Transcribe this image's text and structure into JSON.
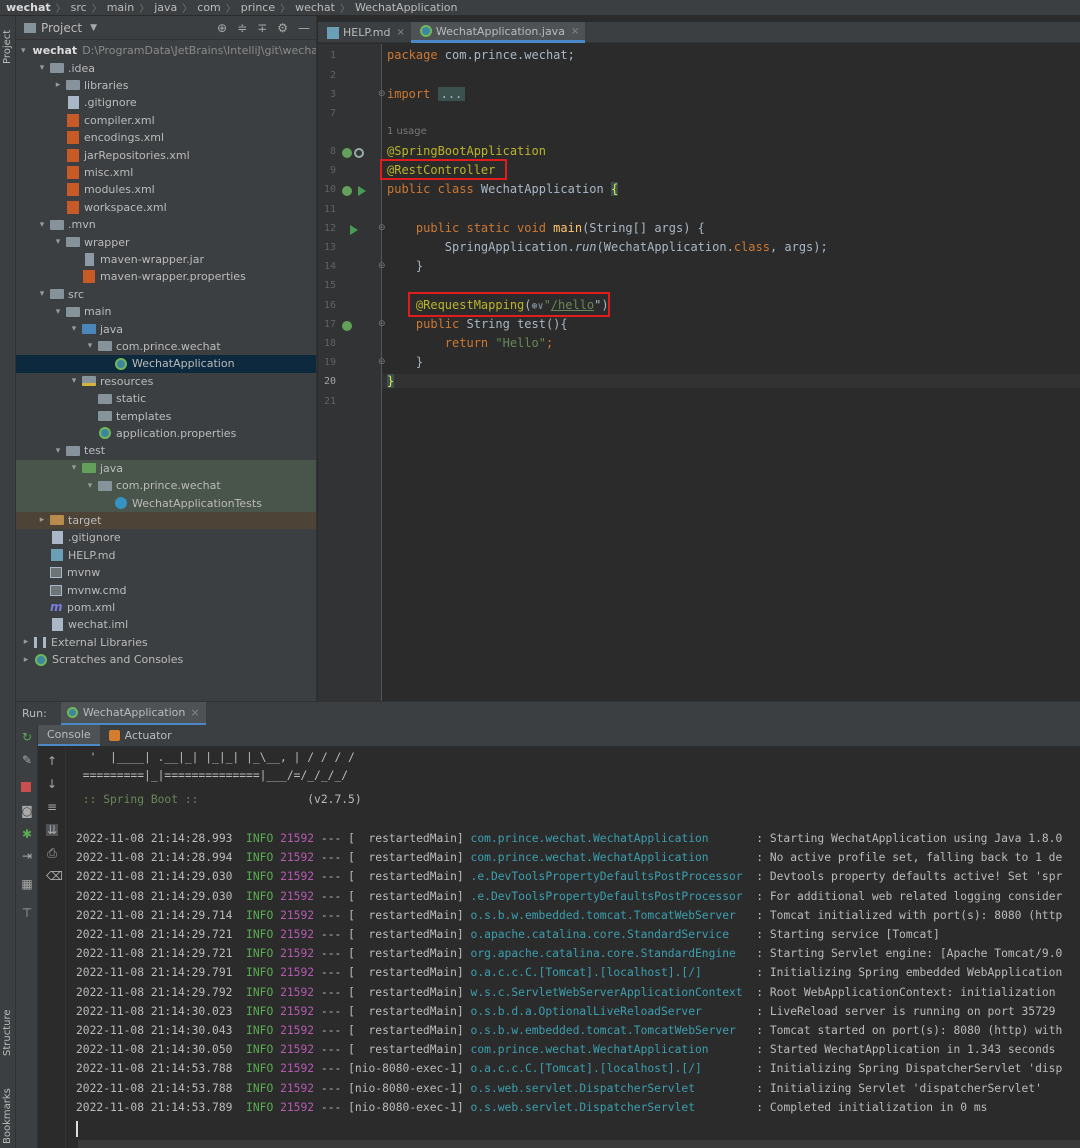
{
  "breadcrumb": [
    "wechat",
    "src",
    "main",
    "java",
    "com",
    "prince",
    "wechat",
    "WechatApplication"
  ],
  "left_strip": {
    "project_label": "Project",
    "structure_label": "Structure",
    "bookmarks_label": "Bookmarks"
  },
  "project_panel": {
    "title": "Project",
    "tree": [
      {
        "label": "wechat",
        "extra": "D:\\ProgramData\\JetBrains\\IntelliJ\\git\\wecha",
        "icon": "folder",
        "depth": 0,
        "arrow": "open",
        "bold": true
      },
      {
        "label": ".idea",
        "icon": "folder",
        "depth": 1,
        "arrow": "open"
      },
      {
        "label": "libraries",
        "icon": "folder",
        "depth": 2,
        "arrow": "closed"
      },
      {
        "label": ".gitignore",
        "icon": "file",
        "depth": 2
      },
      {
        "label": "compiler.xml",
        "icon": "xml",
        "depth": 2
      },
      {
        "label": "encodings.xml",
        "icon": "xml",
        "depth": 2
      },
      {
        "label": "jarRepositories.xml",
        "icon": "xml",
        "depth": 2
      },
      {
        "label": "misc.xml",
        "icon": "xml",
        "depth": 2
      },
      {
        "label": "modules.xml",
        "icon": "xml",
        "depth": 2
      },
      {
        "label": "workspace.xml",
        "icon": "xml",
        "depth": 2
      },
      {
        "label": ".mvn",
        "icon": "folder",
        "depth": 1,
        "arrow": "open"
      },
      {
        "label": "wrapper",
        "icon": "folder",
        "depth": 2,
        "arrow": "open"
      },
      {
        "label": "maven-wrapper.jar",
        "icon": "jar",
        "depth": 3
      },
      {
        "label": "maven-wrapper.properties",
        "icon": "xml",
        "depth": 3
      },
      {
        "label": "src",
        "icon": "folder",
        "depth": 1,
        "arrow": "open"
      },
      {
        "label": "main",
        "icon": "folder",
        "depth": 2,
        "arrow": "open"
      },
      {
        "label": "java",
        "icon": "folder-blue",
        "depth": 3,
        "arrow": "open"
      },
      {
        "label": "com.prince.wechat",
        "icon": "folder",
        "depth": 4,
        "arrow": "open"
      },
      {
        "label": "WechatApplication",
        "icon": "spring",
        "depth": 5,
        "selected": true
      },
      {
        "label": "resources",
        "icon": "folder-res",
        "depth": 3,
        "arrow": "open"
      },
      {
        "label": "static",
        "icon": "folder",
        "depth": 4
      },
      {
        "label": "templates",
        "icon": "folder",
        "depth": 4
      },
      {
        "label": "application.properties",
        "icon": "spring",
        "depth": 4
      },
      {
        "label": "test",
        "icon": "folder",
        "depth": 2,
        "arrow": "open"
      },
      {
        "label": "java",
        "icon": "folder-green",
        "depth": 3,
        "arrow": "open",
        "bg": "test"
      },
      {
        "label": "com.prince.wechat",
        "icon": "folder",
        "depth": 4,
        "arrow": "open",
        "bg": "test"
      },
      {
        "label": "WechatApplicationTests",
        "icon": "cls",
        "depth": 5,
        "bg": "test"
      },
      {
        "label": "target",
        "icon": "folder-orange",
        "depth": 1,
        "arrow": "closed",
        "bg": "target"
      },
      {
        "label": ".gitignore",
        "icon": "file",
        "depth": 1
      },
      {
        "label": "HELP.md",
        "icon": "md",
        "depth": 1
      },
      {
        "label": "mvnw",
        "icon": "mvnw",
        "depth": 1
      },
      {
        "label": "mvnw.cmd",
        "icon": "mvnw",
        "depth": 1
      },
      {
        "label": "pom.xml",
        "icon": "pom",
        "depth": 1
      },
      {
        "label": "wechat.iml",
        "icon": "file",
        "depth": 1
      },
      {
        "label": "External Libraries",
        "icon": "lib",
        "depth": 0,
        "arrow": "closed"
      },
      {
        "label": "Scratches and Consoles",
        "icon": "spring",
        "depth": 0,
        "arrow": "closed"
      }
    ]
  },
  "editor_tabs": [
    {
      "label": "HELP.md",
      "icon": "md",
      "active": false
    },
    {
      "label": "WechatApplication.java",
      "icon": "spring",
      "active": true
    }
  ],
  "editor": {
    "line_numbers": [
      "1",
      "2",
      "3",
      "7",
      "8",
      "9",
      "10",
      "11",
      "12",
      "13",
      "14",
      "15",
      "16",
      "17",
      "18",
      "19",
      "20",
      "21"
    ],
    "usage_hint": "1 usage",
    "code": {
      "package_kw": "package",
      "package_name": " com.prince.wechat;",
      "import_kw": "import",
      "import_fold": "...",
      "ann_boot": "@SpringBootApplication",
      "ann_rest": "@RestController",
      "class_kw": "public class",
      "class_name": " WechatApplication ",
      "brace_open": "{",
      "main_kw": "public static void",
      "main_name": " main",
      "main_params": "(String[] args) {",
      "run_class": "SpringApplication.",
      "run_method": "run",
      "run_args_a": "(WechatApplication.",
      "run_class_kw": "class",
      "run_args_b": ", args);",
      "close_brace": "}",
      "req_ann": "@RequestMapping",
      "req_open": "(",
      "req_icon": "⊛∨",
      "req_quote_open": "\"",
      "req_path": "/hello",
      "req_quote_close": "\")",
      "test_kw": "public",
      "test_sig": " String test(){",
      "return_kw": "return",
      "return_val": " \"Hello\"",
      "semicolon": ";",
      "brace_close": "}"
    }
  },
  "run_panel": {
    "label": "Run:",
    "tab": "WechatApplication",
    "console_tabs": [
      "Console",
      "Actuator"
    ]
  },
  "console": {
    "ascii": [
      "  '  |____| .__|_| |_|_| |_\\__, | / / / /",
      " =========|_|==============|___/=/_/_/_/"
    ],
    "boot_name": " :: Spring Boot :: ",
    "boot_version": "               (v2.7.5)",
    "logs": [
      {
        "date": "2022-11-08 21:14:28.993",
        "level": "INFO",
        "pid": "21592",
        "sep": " --- [",
        "thread": "  restartedMain]",
        "logger": "com.prince.wechat.WechatApplication",
        "pad": "      ",
        "msg": ": Starting WechatApplication using Java 1.8.0"
      },
      {
        "date": "2022-11-08 21:14:28.994",
        "level": "INFO",
        "pid": "21592",
        "sep": " --- [",
        "thread": "  restartedMain]",
        "logger": "com.prince.wechat.WechatApplication",
        "pad": "      ",
        "msg": ": No active profile set, falling back to 1 de"
      },
      {
        "date": "2022-11-08 21:14:29.030",
        "level": "INFO",
        "pid": "21592",
        "sep": " --- [",
        "thread": "  restartedMain]",
        "logger": ".e.DevToolsPropertyDefaultsPostProcessor",
        "pad": " ",
        "msg": ": Devtools property defaults active! Set 'spr"
      },
      {
        "date": "2022-11-08 21:14:29.030",
        "level": "INFO",
        "pid": "21592",
        "sep": " --- [",
        "thread": "  restartedMain]",
        "logger": ".e.DevToolsPropertyDefaultsPostProcessor",
        "pad": " ",
        "msg": ": For additional web related logging consider"
      },
      {
        "date": "2022-11-08 21:14:29.714",
        "level": "INFO",
        "pid": "21592",
        "sep": " --- [",
        "thread": "  restartedMain]",
        "logger": "o.s.b.w.embedded.tomcat.TomcatWebServer",
        "pad": "  ",
        "msg": ": Tomcat initialized with port(s): 8080 (http"
      },
      {
        "date": "2022-11-08 21:14:29.721",
        "level": "INFO",
        "pid": "21592",
        "sep": " --- [",
        "thread": "  restartedMain]",
        "logger": "o.apache.catalina.core.StandardService",
        "pad": "   ",
        "msg": ": Starting service [Tomcat]"
      },
      {
        "date": "2022-11-08 21:14:29.721",
        "level": "INFO",
        "pid": "21592",
        "sep": " --- [",
        "thread": "  restartedMain]",
        "logger": "org.apache.catalina.core.StandardEngine",
        "pad": "  ",
        "msg": ": Starting Servlet engine: [Apache Tomcat/9.0"
      },
      {
        "date": "2022-11-08 21:14:29.791",
        "level": "INFO",
        "pid": "21592",
        "sep": " --- [",
        "thread": "  restartedMain]",
        "logger": "o.a.c.c.C.[Tomcat].[localhost].[/]",
        "pad": "       ",
        "msg": ": Initializing Spring embedded WebApplication"
      },
      {
        "date": "2022-11-08 21:14:29.792",
        "level": "INFO",
        "pid": "21592",
        "sep": " --- [",
        "thread": "  restartedMain]",
        "logger": "w.s.c.ServletWebServerApplicationContext",
        "pad": " ",
        "msg": ": Root WebApplicationContext: initialization"
      },
      {
        "date": "2022-11-08 21:14:30.023",
        "level": "INFO",
        "pid": "21592",
        "sep": " --- [",
        "thread": "  restartedMain]",
        "logger": "o.s.b.d.a.OptionalLiveReloadServer",
        "pad": "       ",
        "msg": ": LiveReload server is running on port 35729"
      },
      {
        "date": "2022-11-08 21:14:30.043",
        "level": "INFO",
        "pid": "21592",
        "sep": " --- [",
        "thread": "  restartedMain]",
        "logger": "o.s.b.w.embedded.tomcat.TomcatWebServer",
        "pad": "  ",
        "msg": ": Tomcat started on port(s): 8080 (http) with"
      },
      {
        "date": "2022-11-08 21:14:30.050",
        "level": "INFO",
        "pid": "21592",
        "sep": " --- [",
        "thread": "  restartedMain]",
        "logger": "com.prince.wechat.WechatApplication",
        "pad": "      ",
        "msg": ": Started WechatApplication in 1.343 seconds"
      },
      {
        "date": "2022-11-08 21:14:53.788",
        "level": "INFO",
        "pid": "21592",
        "sep": " --- [",
        "thread": "nio-8080-exec-1]",
        "logger": "o.a.c.c.C.[Tomcat].[localhost].[/]",
        "pad": "       ",
        "msg": ": Initializing Spring DispatcherServlet 'disp"
      },
      {
        "date": "2022-11-08 21:14:53.788",
        "level": "INFO",
        "pid": "21592",
        "sep": " --- [",
        "thread": "nio-8080-exec-1]",
        "logger": "o.s.web.servlet.DispatcherServlet",
        "pad": "        ",
        "msg": ": Initializing Servlet 'dispatcherServlet'"
      },
      {
        "date": "2022-11-08 21:14:53.789",
        "level": "INFO",
        "pid": "21592",
        "sep": " --- [",
        "thread": "nio-8080-exec-1]",
        "logger": "o.s.web.servlet.DispatcherServlet",
        "pad": "        ",
        "msg": ": Completed initialization in 0 ms"
      }
    ]
  },
  "colors": {
    "background": "#2b2b2b",
    "panel": "#3c3f41",
    "keyword": "#cc7832",
    "annotation": "#bbb529",
    "string": "#6a8759",
    "highlight_box": "#e11c1c",
    "log_info": "#5aab52",
    "log_pid": "#b55ab0",
    "log_logger": "#3b9fb0"
  }
}
